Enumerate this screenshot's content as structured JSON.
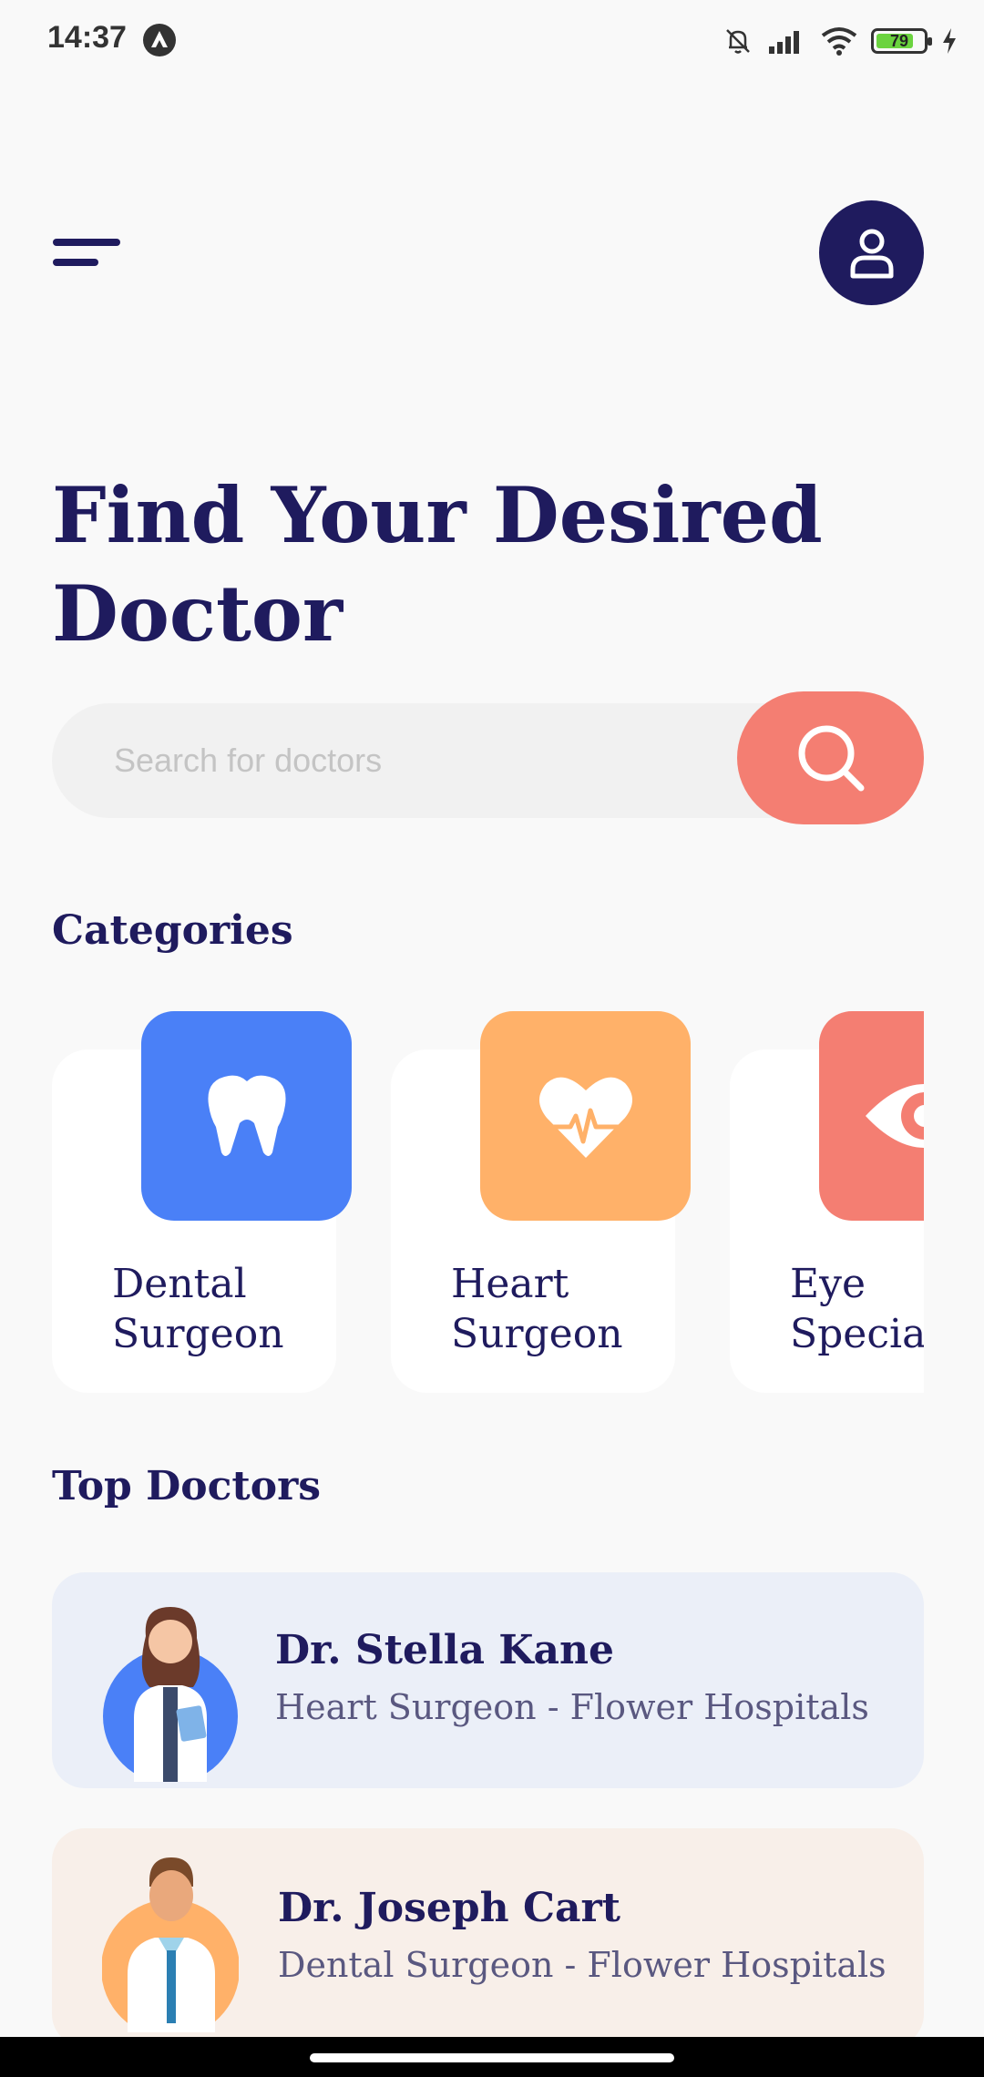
{
  "status_bar": {
    "time": "14:37",
    "battery": "79"
  },
  "header": {
    "title": "Find Your Desired Doctor"
  },
  "search": {
    "placeholder": "Search for doctors"
  },
  "categories": {
    "title": "Categories",
    "items": [
      {
        "label": "Dental\nSurgeon",
        "icon": "tooth-icon",
        "color": "#4a80f7"
      },
      {
        "label": "Heart\nSurgeon",
        "icon": "heart-pulse-icon",
        "color": "#ffb169"
      },
      {
        "label": "Eye\nSpecialist",
        "icon": "eye-icon",
        "color": "#f47e72"
      }
    ]
  },
  "top_doctors": {
    "title": "Top Doctors",
    "items": [
      {
        "name": "Dr. Stella Kane",
        "subtitle": "Heart Surgeon - Flower Hospitals",
        "card_color": "#ebeff8",
        "avatar_color": "#4a80f7"
      },
      {
        "name": "Dr. Joseph Cart",
        "subtitle": "Dental Surgeon - Flower Hospitals",
        "card_color": "#f8efe9",
        "avatar_color": "#ffb169"
      }
    ]
  },
  "colors": {
    "primary": "#1f1b5e",
    "accent": "#f47e72",
    "background": "#f9f9f9"
  }
}
